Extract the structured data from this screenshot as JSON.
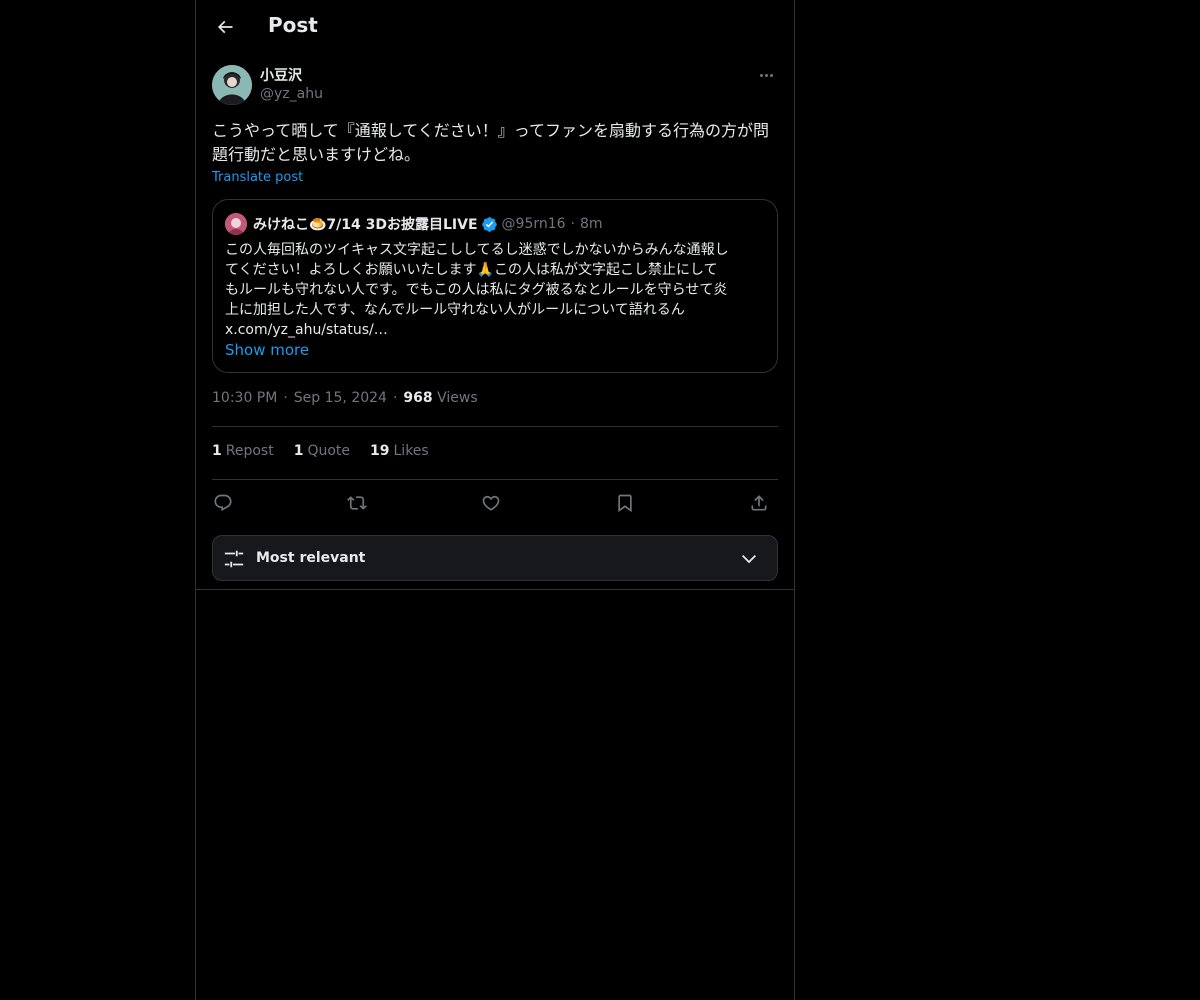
{
  "header": {
    "title": "Post"
  },
  "post": {
    "author_name": "小豆沢",
    "author_handle": "@yz_ahu",
    "text": "こうやって晒して『通報してください！』ってファンを扇動する行為の方が問題行動だと思いますけどね。",
    "translate_label": "Translate post",
    "time": "10:30 PM",
    "date": "Sep 15, 2024",
    "views_count": "968",
    "views_label": "Views"
  },
  "quote": {
    "name": "みけねこ🍮7/14 3Dお披露目LIVE",
    "handle": "@95rn16",
    "dot": "·",
    "time": "8m",
    "lines": [
      "この人毎回私のツイキャス文字起こししてるし迷惑でしかないからみんな通報し",
      "てください！よろしくお願いいたします🙏この人は私が文字起こし禁止にして",
      "もルールも守れない人です。でもこの人は私にタグ被るなとルールを守らせて炎",
      "上に加担した人です、なんでルール守れない人がルールについて語れるん",
      "x.com/yz_ahu/status/…"
    ],
    "show_more": "Show more"
  },
  "meta": {
    "sep": "·"
  },
  "stats": {
    "reposts_count": "1",
    "reposts_label": "Repost",
    "quotes_count": "1",
    "quotes_label": "Quote",
    "likes_count": "19",
    "likes_label": "Likes"
  },
  "actions": [
    "reply-icon",
    "repost-icon",
    "like-icon",
    "bookmark-icon",
    "share-icon"
  ],
  "sort": {
    "label": "Most relevant"
  },
  "colors": {
    "accent": "#1d9bf0",
    "background": "#000000",
    "muted": "#71767b",
    "text": "#e7e9ea",
    "border": "#2f3336"
  }
}
